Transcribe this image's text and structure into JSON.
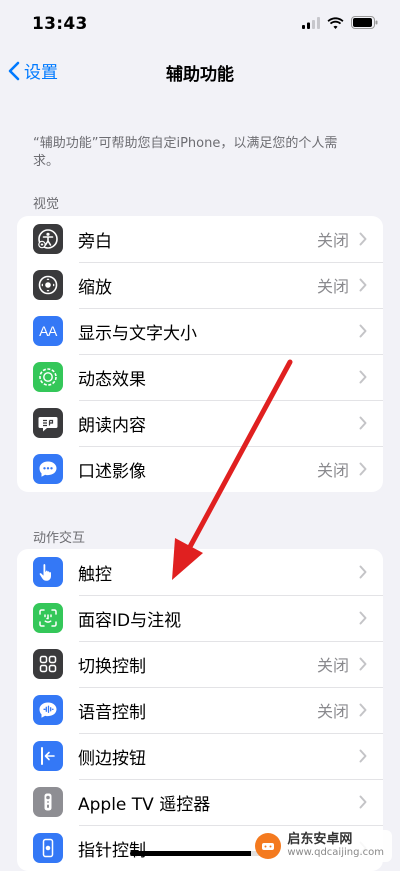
{
  "status_bar": {
    "time": "13:43"
  },
  "nav": {
    "back_label": "设置",
    "title": "辅助功能"
  },
  "description": "“辅助功能”可帮助您自定iPhone，以满足您的个人需求。",
  "sections": [
    {
      "header": "视觉",
      "rows": [
        {
          "icon": "voiceover-icon",
          "label": "旁白",
          "value": "关闭",
          "color": "#3a3a3c"
        },
        {
          "icon": "zoom-icon",
          "label": "缩放",
          "value": "关闭",
          "color": "#3a3a3c"
        },
        {
          "icon": "text-size-icon",
          "label": "显示与文字大小",
          "value": "",
          "color": "#3478f6",
          "glyph": "AA"
        },
        {
          "icon": "motion-icon",
          "label": "动态效果",
          "value": "",
          "color": "#34c759"
        },
        {
          "icon": "spoken-content-icon",
          "label": "朗读内容",
          "value": "",
          "color": "#3a3a3c"
        },
        {
          "icon": "audio-description-icon",
          "label": "口述影像",
          "value": "关闭",
          "color": "#3478f6"
        }
      ]
    },
    {
      "header": "动作交互",
      "rows": [
        {
          "icon": "touch-icon",
          "label": "触控",
          "value": "",
          "color": "#3478f6"
        },
        {
          "icon": "face-id-icon",
          "label": "面容ID与注视",
          "value": "",
          "color": "#34c759"
        },
        {
          "icon": "switch-control-icon",
          "label": "切换控制",
          "value": "关闭",
          "color": "#3a3a3c"
        },
        {
          "icon": "voice-control-icon",
          "label": "语音控制",
          "value": "关闭",
          "color": "#3478f6"
        },
        {
          "icon": "side-button-icon",
          "label": "侧边按钮",
          "value": "",
          "color": "#3478f6"
        },
        {
          "icon": "apple-tv-remote-icon",
          "label": "Apple TV 遥控器",
          "value": "",
          "color": "#8e8e93"
        },
        {
          "icon": "pointer-control-icon",
          "label": "指针控制",
          "value": "",
          "color": "#3478f6"
        }
      ]
    }
  ],
  "watermark": {
    "name": "启东安卓网",
    "url": "www.qdcaijing.com",
    "color": "#f47a1f"
  },
  "annotation": {
    "color": "#e02020"
  }
}
